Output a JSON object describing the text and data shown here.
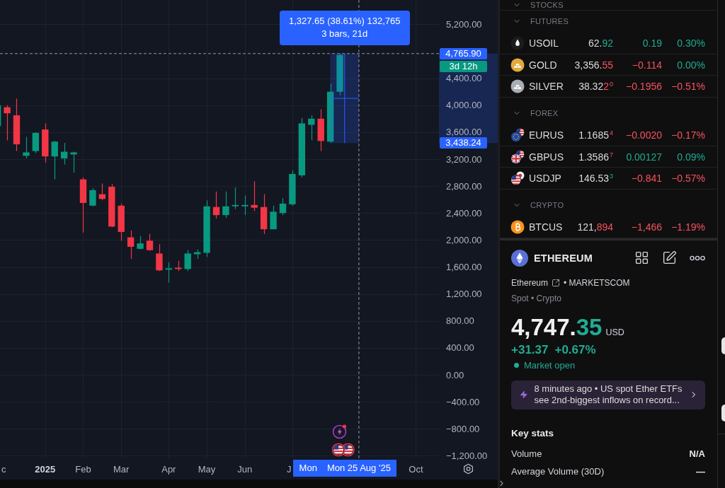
{
  "chart": {
    "price_axis": [
      "5,200.00",
      "4,400.00",
      "4,000.00",
      "3,600.00",
      "3,200.00",
      "2,800.00",
      "2,400.00",
      "2,000.00",
      "1,600.00",
      "1,200.00",
      "800.00",
      "400.00",
      "0.00",
      "−400.00",
      "−800.00",
      "−1,200.00"
    ],
    "time_axis": [
      "c",
      "2025",
      "Feb",
      "Mar",
      "Apr",
      "May",
      "Jun",
      "J",
      "Oct"
    ],
    "measure": {
      "lines": [
        "1,327.65 (38.61%) 132,765",
        "3 bars, 21d"
      ],
      "start_price": "3,438.24",
      "start_date": "Mon"
    },
    "crosshair": {
      "price": "4,765.90",
      "date": "Mon 25 Aug '25"
    },
    "countdown": "3d 12h"
  },
  "watchlist": {
    "sections": [
      {
        "title": "STOCKS",
        "expanded": true
      },
      {
        "title": "FUTURES",
        "expanded": true,
        "rows": [
          {
            "symbol": "USOIL",
            "price": {
              "main": "62.",
              "tick": "92",
              "down": false
            },
            "change": {
              "text": "0.19",
              "down": false
            },
            "change_percent": {
              "text": "0.30%",
              "down": false
            }
          },
          {
            "symbol": "GOLD",
            "price": {
              "main": "3,356.",
              "tick": "55",
              "down": true
            },
            "change": {
              "text": "−0.114",
              "down": true
            },
            "change_percent": {
              "text": "0.00%",
              "down": false
            }
          },
          {
            "symbol": "SILVER",
            "price": {
              "main": "38.32",
              "tick": "2",
              "pip": "0",
              "down": true
            },
            "change": {
              "text": "−0.1956",
              "down": true
            },
            "change_percent": {
              "text": "−0.51%",
              "down": true
            }
          }
        ]
      },
      {
        "title": "FOREX",
        "expanded": true,
        "rows": [
          {
            "symbol": "EURUS",
            "price": {
              "main": "1.1685",
              "pip": "4",
              "down": true
            },
            "change": {
              "text": "−0.0020",
              "down": true
            },
            "change_percent": {
              "text": "−0.17%",
              "down": true
            }
          },
          {
            "symbol": "GBPUS",
            "price": {
              "main": "1.3586",
              "pip": "7",
              "down": true
            },
            "change": {
              "text": "0.00127",
              "down": false
            },
            "change_percent": {
              "text": "0.09%",
              "down": false
            }
          },
          {
            "symbol": "USDJP",
            "price": {
              "main": "146.53",
              "pip": "3",
              "down": false
            },
            "change": {
              "text": "−0.841",
              "down": true
            },
            "change_percent": {
              "text": "−0.57%",
              "down": true
            }
          }
        ]
      },
      {
        "title": "CRYPTO",
        "expanded": true,
        "rows": [
          {
            "symbol": "BTCUS",
            "price": {
              "main": "121,",
              "tick": "894",
              "down": true
            },
            "change": {
              "text": "−1,466",
              "down": true
            },
            "change_percent": {
              "text": "−1.19%",
              "down": true
            }
          }
        ]
      }
    ]
  },
  "details": {
    "name": "ETHEREUM",
    "source": "Ethereum",
    "exchange": "• MARKETSCOM",
    "category": "Spot • Crypto",
    "price": {
      "main": "4,747.",
      "tick": "35",
      "down": false
    },
    "currency": "USD",
    "change": {
      "text": "+31.37",
      "down": false
    },
    "change_percent": {
      "text": "+0.67%",
      "down": false
    },
    "market_status": {
      "text": "Market open",
      "open": true
    },
    "news": {
      "lines": [
        "8 minutes ago • US spot Ether ETFs",
        "see 2nd-biggest inflows on record..."
      ]
    },
    "key_stats": {
      "title": "Key stats",
      "rows": [
        {
          "label": "Volume",
          "value": "N/A"
        },
        {
          "label": "Average Volume (30D)",
          "value": "—"
        }
      ]
    }
  }
}
